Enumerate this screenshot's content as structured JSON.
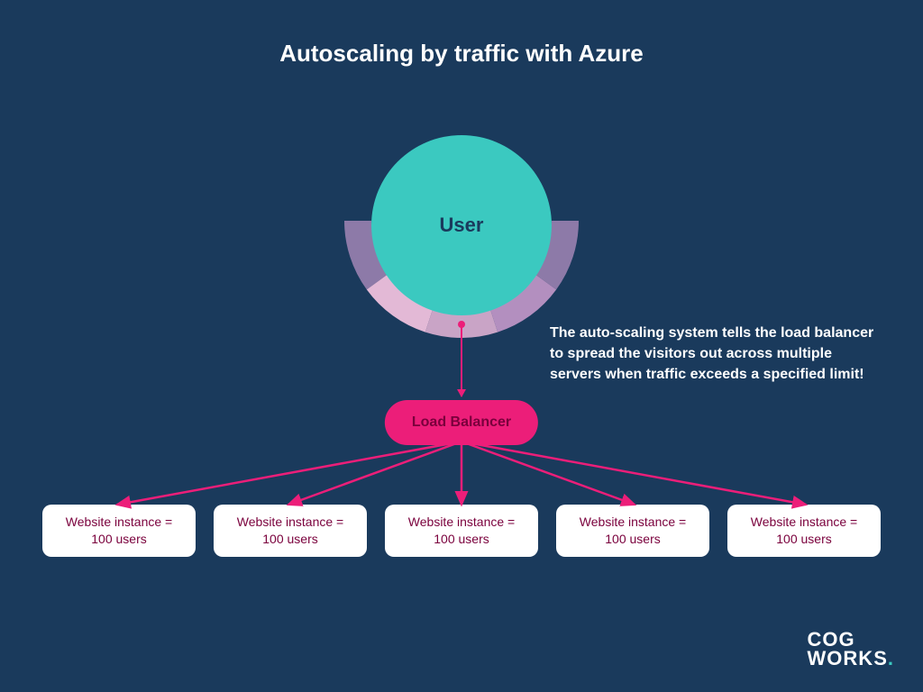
{
  "title": "Autoscaling by traffic with Azure",
  "user_label": "User",
  "load_balancer_label": "Load Balancer",
  "explanation": "The auto-scaling system tells the load balancer to spread the visitors out across multiple servers when traffic exceeds a specified limit!",
  "instances": [
    "Website instance = 100 users",
    "Website instance = 100 users",
    "Website instance = 100 users",
    "Website instance = 100 users",
    "Website instance = 100 users"
  ],
  "logo": {
    "line1": "COG",
    "line2": "WORKS"
  },
  "colors": {
    "background": "#1a3a5c",
    "accent_teal": "#3bc9c0",
    "accent_pink": "#ec1e79",
    "ring_segments": [
      "#8d7aa8",
      "#e3b9d6",
      "#c9a4c6",
      "#b38fbf",
      "#8d7aa8"
    ]
  }
}
